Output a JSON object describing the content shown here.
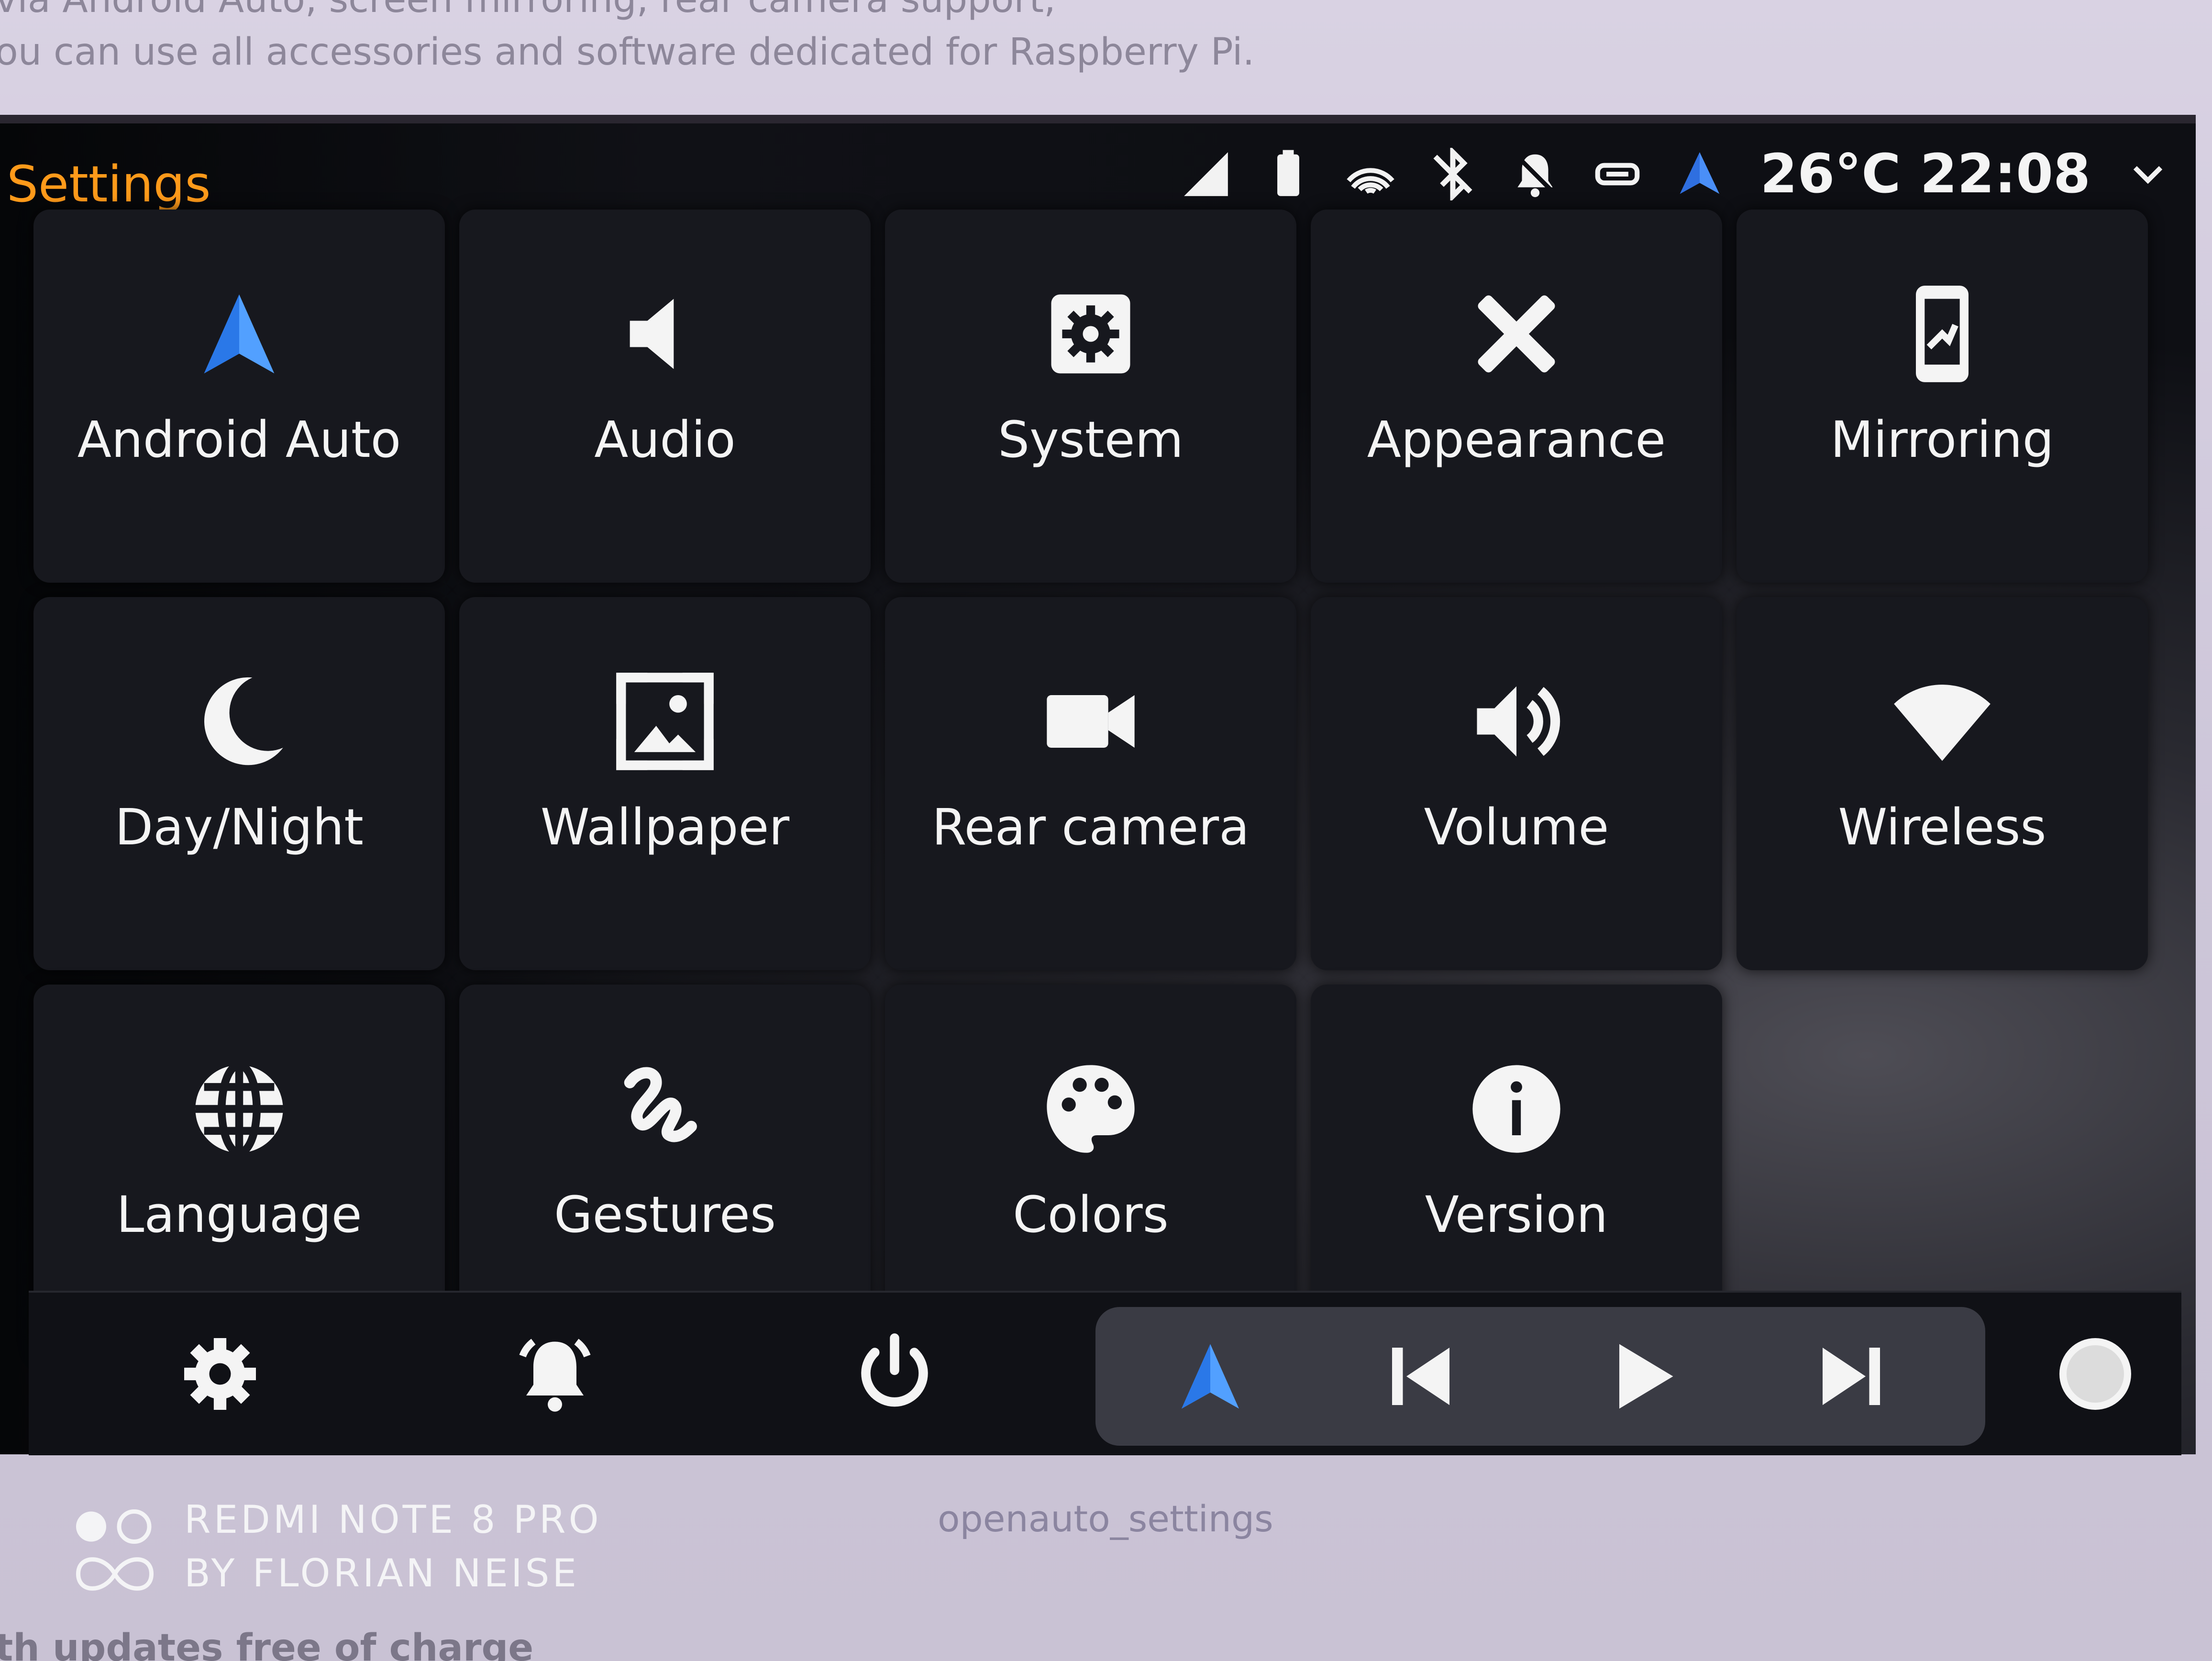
{
  "background_page": {
    "line_top_1": "via Android Auto, screen mirroring, rear camera support,",
    "line_top_2": "ou can use all accessories and software dedicated for Raspberry Pi.",
    "line_bottom": "th updates free of charge",
    "caption": "openauto_settings",
    "watermark_line_1": "REDMI NOTE 8 PRO",
    "watermark_line_2": "BY FLORIAN NEISE"
  },
  "app": {
    "title": "Settings",
    "accent_color": "#ff9a1a"
  },
  "status_bar": {
    "icons": [
      "signal-icon",
      "battery-icon",
      "wifi-icon",
      "bluetooth-off-icon",
      "alarm-off-icon",
      "cable-icon",
      "android-auto-icon"
    ],
    "temperature": "26°C",
    "time": "22:08"
  },
  "tiles": [
    {
      "label": "Android Auto",
      "icon": "android-auto-icon"
    },
    {
      "label": "Audio",
      "icon": "speaker-icon"
    },
    {
      "label": "System",
      "icon": "gear-box-icon"
    },
    {
      "label": "Appearance",
      "icon": "brush-ruler-icon"
    },
    {
      "label": "Mirroring",
      "icon": "phone-mirror-icon"
    },
    {
      "label": "Day/Night",
      "icon": "moon-icon"
    },
    {
      "label": "Wallpaper",
      "icon": "image-icon"
    },
    {
      "label": "Rear camera",
      "icon": "video-camera-icon"
    },
    {
      "label": "Volume",
      "icon": "volume-icon"
    },
    {
      "label": "Wireless",
      "icon": "wifi-wedge-icon"
    },
    {
      "label": "Language",
      "icon": "globe-icon"
    },
    {
      "label": "Gestures",
      "icon": "gesture-icon"
    },
    {
      "label": "Colors",
      "icon": "palette-icon"
    },
    {
      "label": "Version",
      "icon": "info-icon"
    }
  ],
  "bottom_bar": {
    "left_buttons": [
      "settings-gear-icon",
      "alarm-bell-icon",
      "power-icon"
    ],
    "media_buttons": [
      "android-auto-icon",
      "skip-previous-icon",
      "play-icon",
      "skip-next-icon"
    ],
    "right_button": "home-circle-icon"
  }
}
